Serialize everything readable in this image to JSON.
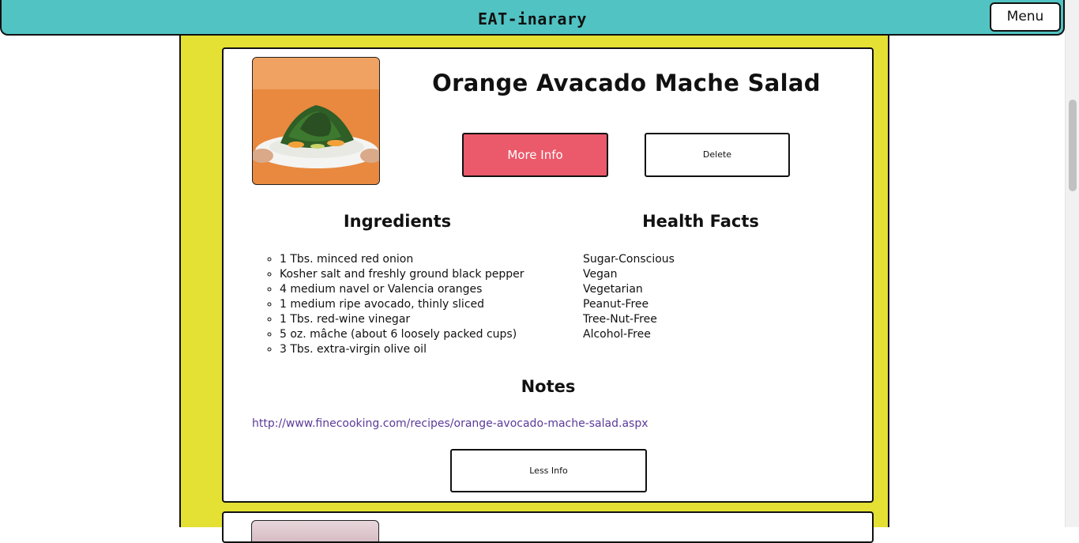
{
  "header": {
    "title": "EAT-inarary",
    "menu_label": "Menu"
  },
  "recipe": {
    "title": "Orange Avacado Mache Salad",
    "photo_alt": "salad plate photo",
    "buttons": {
      "more_info": "More Info",
      "delete": "Delete",
      "less_info": "Less Info"
    },
    "ingredients_heading": "Ingredients",
    "ingredients": [
      "1 Tbs. minced red onion",
      "Kosher salt and freshly ground black pepper",
      "4 medium navel or Valencia oranges",
      "1 medium ripe avocado, thinly sliced",
      "1 Tbs. red-wine vinegar",
      "5 oz. mâche (about 6 loosely packed cups)",
      "3 Tbs. extra-virgin olive oil"
    ],
    "health_heading": "Health Facts",
    "health_facts": [
      "Sugar-Conscious",
      "Vegan",
      "Vegetarian",
      "Peanut-Free",
      "Tree-Nut-Free",
      "Alcohol-Free"
    ],
    "notes_heading": "Notes",
    "notes_link": "http://www.finecooking.com/recipes/orange-avocado-mache-salad.aspx"
  },
  "colors": {
    "header_bg": "#51c3c3",
    "page_bg": "#e5e034",
    "more_info_bg": "#ea5a6b",
    "link": "#5b3a9a"
  }
}
